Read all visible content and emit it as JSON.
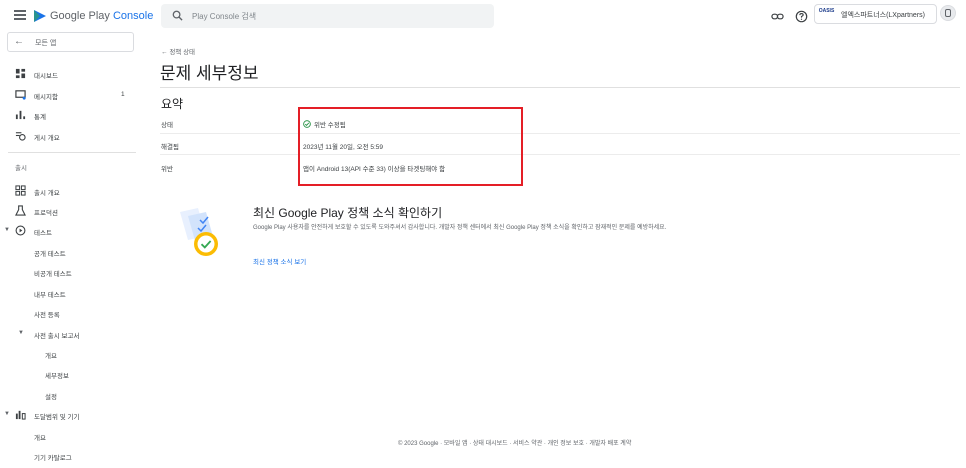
{
  "header": {
    "brand_name": "Google Play ",
    "brand_suffix": "Console",
    "search_placeholder": "Play Console 검색",
    "developer_logo_text": "OASIS",
    "developer_name": "엘엑스파트너스(LXpartners)"
  },
  "sidebar": {
    "all_apps": "모든 앱",
    "top_items": [
      {
        "label": "대시보드",
        "icon": "dashboard-icon"
      },
      {
        "label": "메시지함",
        "icon": "inbox-icon",
        "count": "1"
      },
      {
        "label": "통계",
        "icon": "bar-chart-icon"
      },
      {
        "label": "게시 개요",
        "icon": "publishing-icon"
      }
    ],
    "release_section": "출시",
    "release_items": [
      {
        "label": "출시 개요",
        "icon": "release-overview-icon"
      },
      {
        "label": "프로덕션",
        "icon": "production-icon"
      },
      {
        "label": "테스트",
        "icon": "testing-icon"
      },
      {
        "label": "공개 테스트"
      },
      {
        "label": "비공개 테스트"
      },
      {
        "label": "내부 테스트"
      },
      {
        "label": "사전 등록"
      },
      {
        "label": "사전 출시 보고서"
      },
      {
        "label": "개요"
      },
      {
        "label": "세부정보"
      },
      {
        "label": "설정"
      },
      {
        "label": "도달범위 및 기기",
        "icon": "reach-devices-icon"
      },
      {
        "label": "개요"
      },
      {
        "label": "기기 카탈로그"
      }
    ]
  },
  "main": {
    "breadcrumb": "정책 상태",
    "title": "문제 세부정보",
    "summary_heading": "요약",
    "rows": [
      {
        "label": "상태",
        "value": "위반 수정됨"
      },
      {
        "label": "해결됨",
        "value": "2023년 11월 20일, 오전 5:59"
      },
      {
        "label": "위반",
        "value": "앱이 Android 13(API 수준 33) 이상을 타겟팅해야 함"
      }
    ],
    "news_title": "최신 Google Play 정책 소식 확인하기",
    "news_body": "Google Play 사용자를 안전하게 보호할 수 있도록 도와주셔서 감사합니다. 개발자 정책 센터에서 최신 Google Play 정책 소식을 확인하고 잠재적인 문제를 예방하세요.",
    "news_link": "최신 정책 소식 보기"
  },
  "footer": {
    "text": "© 2023 Google · 모바일 앱 · 상태 대시보드 · 서비스 약관 · 개인 정보 보호 · 개발자 배포 계약"
  },
  "colors": {
    "accent": "#1a73e8",
    "highlight_border": "#e41e26",
    "status_ok": "#1e8e3e"
  }
}
